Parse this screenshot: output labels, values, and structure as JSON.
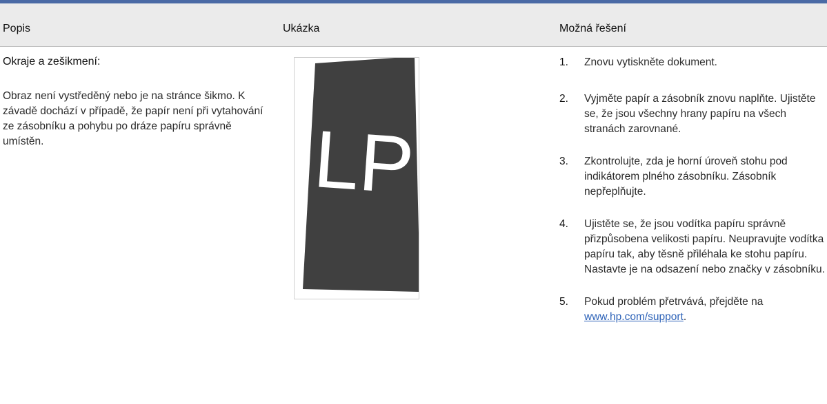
{
  "table": {
    "headers": {
      "description": "Popis",
      "sample": "Ukázka",
      "solutions": "Možná řešení"
    }
  },
  "row": {
    "title": "Okraje a zešikmení:",
    "description": "Obraz není vystředěný nebo je na stránce šikmo. K závadě dochází v případě, že papír není při vytahování ze zásobníku a pohybu po dráze papíru správně umístěn.",
    "sample_letters": "LP",
    "steps": [
      {
        "num": "1.",
        "text": "Znovu vytiskněte dokument."
      },
      {
        "num": "2.",
        "text": "Vyjměte papír a zásobník znovu naplňte. Ujistěte se, že jsou všechny hrany papíru na všech stranách zarovnané."
      },
      {
        "num": "3.",
        "text": "Zkontrolujte, zda je horní úroveň stohu pod indikátorem plného zásobníku. Zásobník nepřeplňujte."
      },
      {
        "num": "4.",
        "text": "Ujistěte se, že jsou vodítka papíru správně přizpůsobena velikosti papíru. Neupravujte vodítka papíru tak, aby těsně přiléhala ke stohu papíru. Nastavte je na odsazení nebo značky v zásobníku."
      },
      {
        "num": "5.",
        "text_before": "Pokud problém přetrvává, přejděte na ",
        "link": "www.hp.com/support",
        "text_after": "."
      }
    ]
  },
  "colors": {
    "accent": "#4a6aa5",
    "header_bg": "#ebebeb",
    "sample_fill": "#404040",
    "link": "#2e63b8"
  }
}
